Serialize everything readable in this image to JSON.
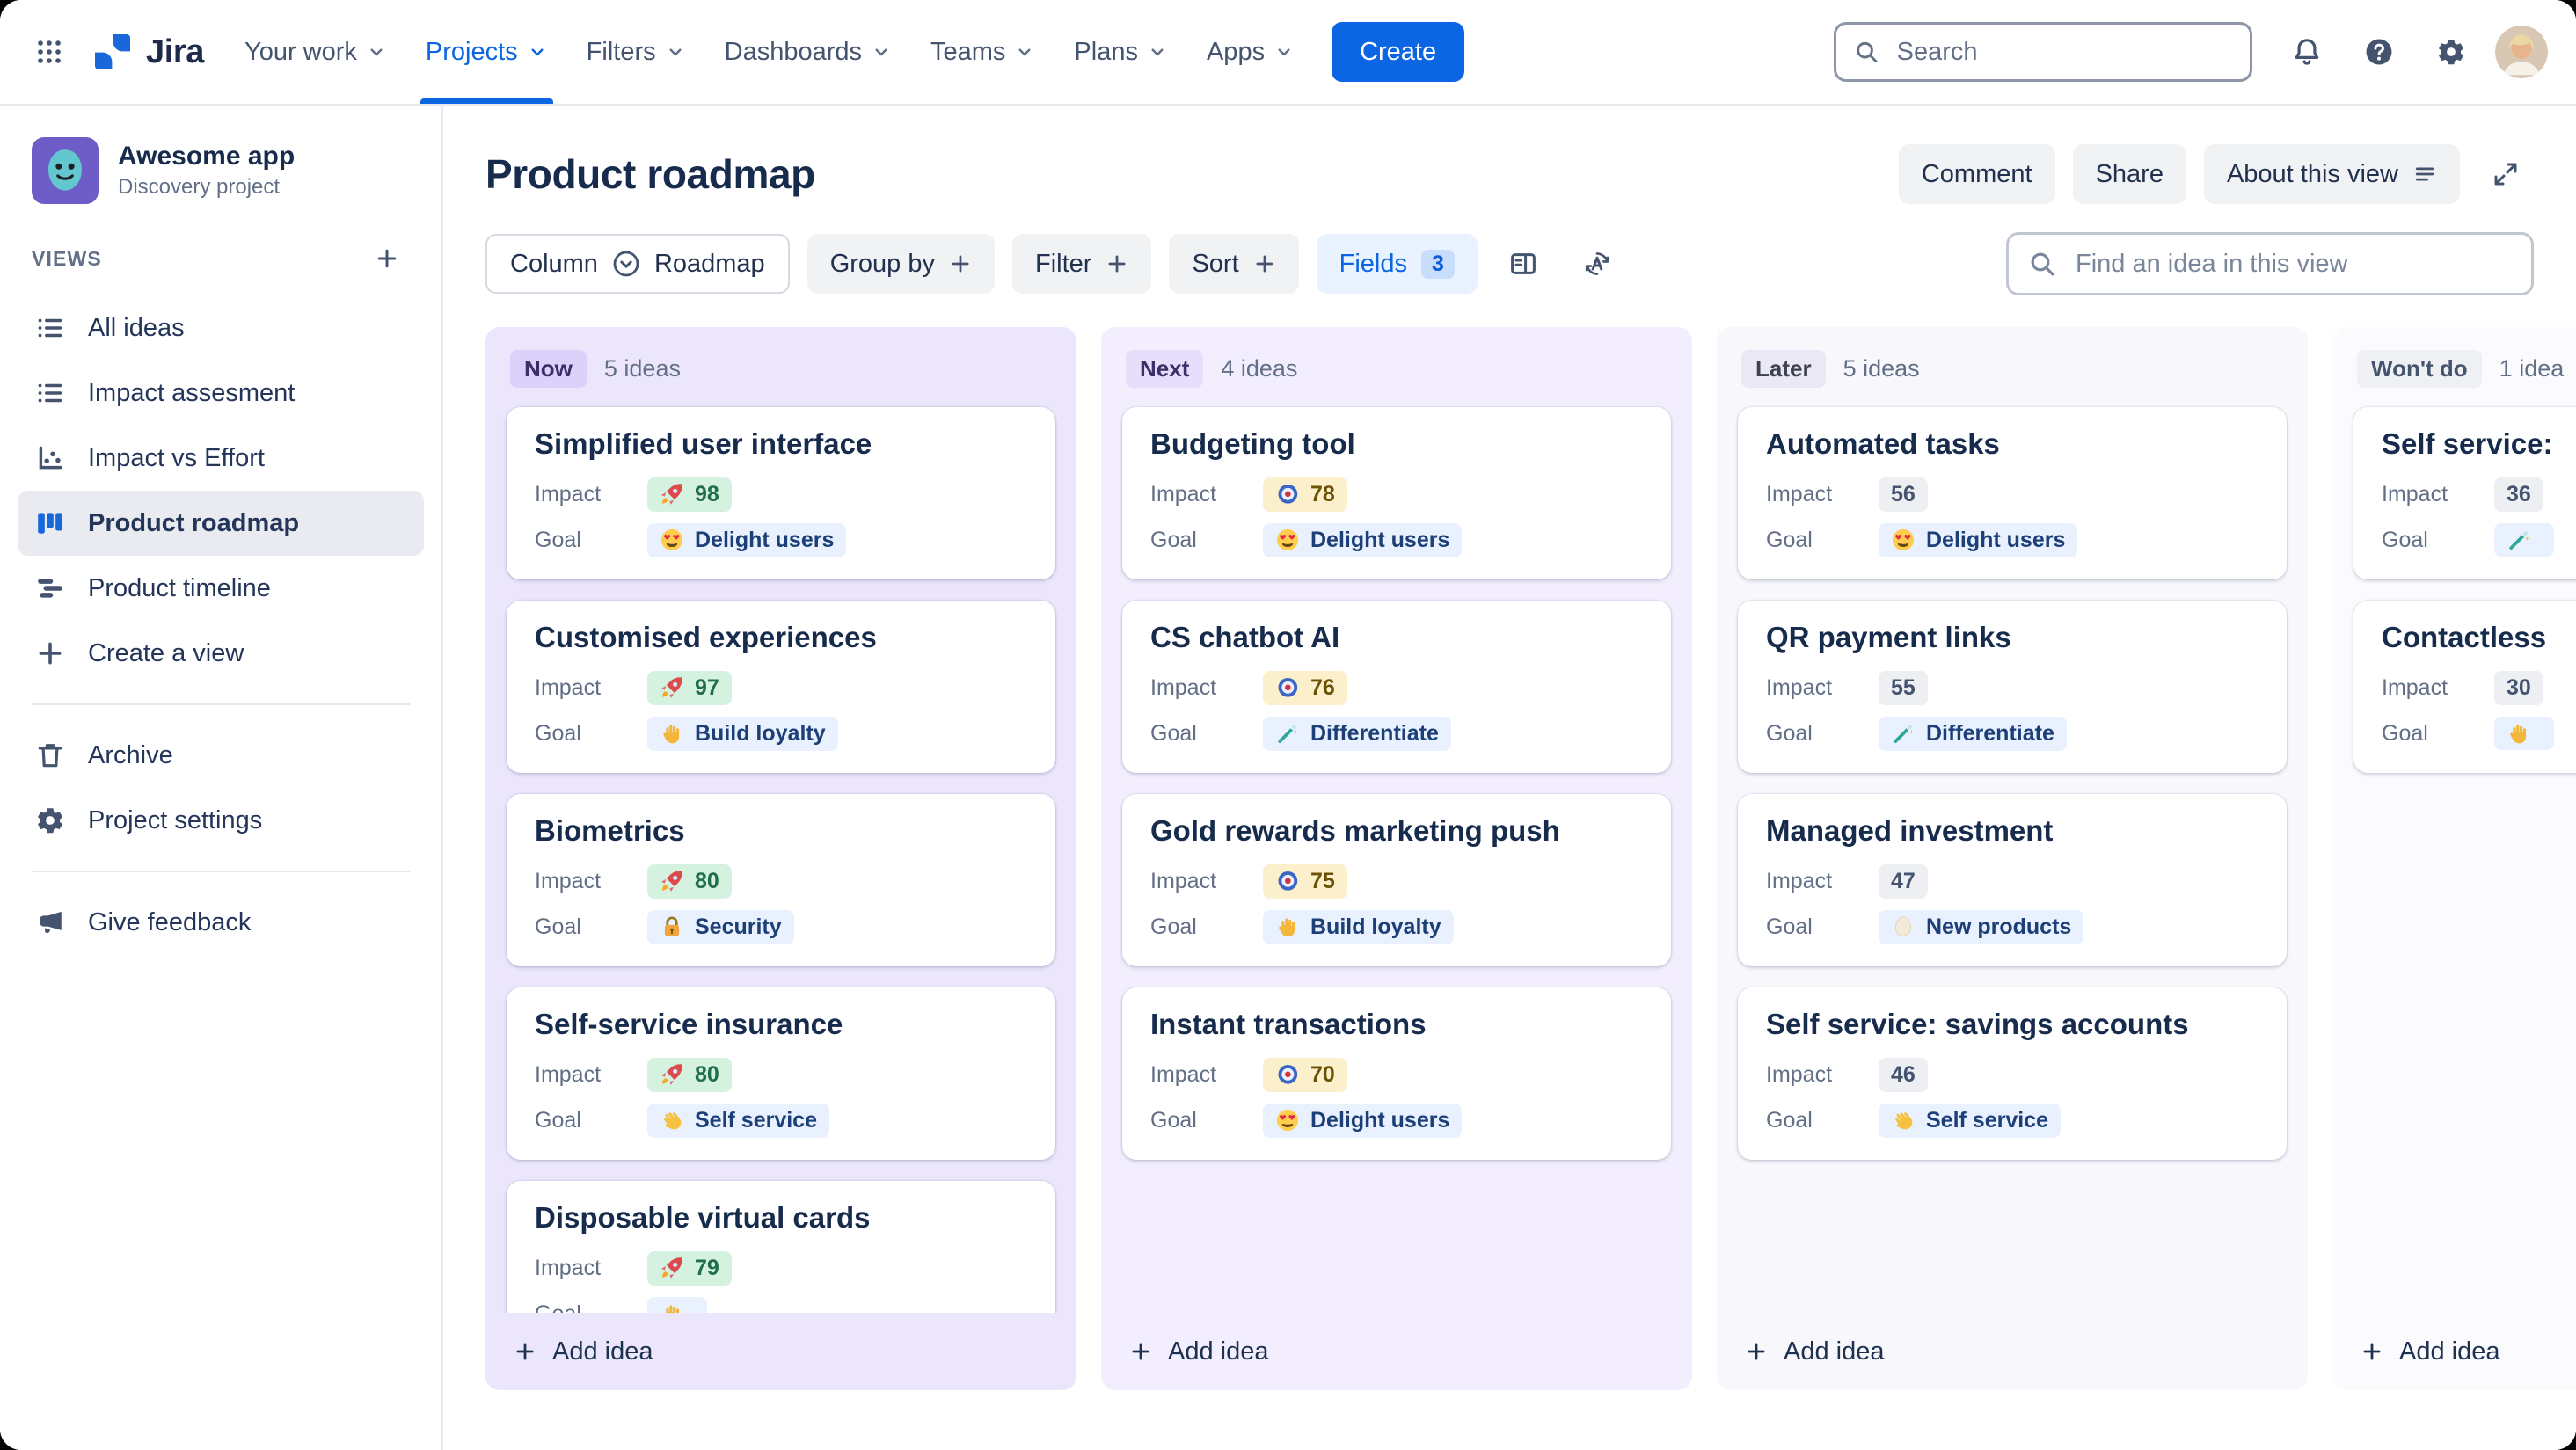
{
  "nav": {
    "logo": "Jira",
    "items": [
      {
        "label": "Your work"
      },
      {
        "label": "Projects"
      },
      {
        "label": "Filters"
      },
      {
        "label": "Dashboards"
      },
      {
        "label": "Teams"
      },
      {
        "label": "Plans"
      },
      {
        "label": "Apps"
      }
    ],
    "create_label": "Create",
    "search_placeholder": "Search"
  },
  "sidebar": {
    "project_name": "Awesome app",
    "project_type": "Discovery project",
    "views_label": "VIEWS",
    "views": [
      {
        "label": "All ideas"
      },
      {
        "label": "Impact assesment"
      },
      {
        "label": "Impact vs Effort"
      },
      {
        "label": "Product roadmap"
      },
      {
        "label": "Product timeline"
      },
      {
        "label": "Create a view"
      }
    ],
    "tools": [
      {
        "label": "Archive"
      },
      {
        "label": "Project settings"
      }
    ],
    "feedback_label": "Give feedback"
  },
  "header": {
    "title": "Product roadmap",
    "comment_label": "Comment",
    "share_label": "Share",
    "about_label": "About this view"
  },
  "toolbar": {
    "column_label": "Column",
    "column_value": "Roadmap",
    "group_by_label": "Group by",
    "filter_label": "Filter",
    "sort_label": "Sort",
    "fields_label": "Fields",
    "fields_count": "3",
    "find_placeholder": "Find an idea in this view"
  },
  "labels": {
    "impact": "Impact",
    "goal": "Goal",
    "add_idea": "Add idea"
  },
  "colors": {
    "accent_blue": "#0C66E4",
    "now_column": "#ECE6FC",
    "next_column": "#F2EEFD",
    "later_column": "#F7F7FC",
    "impact_high": "#D5F2E1",
    "impact_mid": "#FBF0CB",
    "impact_low": "#EDEFF2",
    "goal_badge": "#E8F1FD"
  },
  "board": {
    "columns": [
      {
        "status": "Now",
        "count": "5 ideas",
        "cards": [
          {
            "title": "Simplified user interface",
            "impact": "98",
            "impact_icon": "rocket-icon",
            "goal": "Delight users",
            "goal_icon": "heart-eyes-icon"
          },
          {
            "title": "Customised experiences",
            "impact": "97",
            "impact_icon": "rocket-icon",
            "goal": "Build loyalty",
            "goal_icon": "hand-icon"
          },
          {
            "title": "Biometrics",
            "impact": "80",
            "impact_icon": "rocket-icon",
            "goal": "Security",
            "goal_icon": "lock-icon"
          },
          {
            "title": "Self-service insurance",
            "impact": "80",
            "impact_icon": "rocket-icon",
            "goal": "Self service",
            "goal_icon": "call-me-hand-icon"
          },
          {
            "title": "Disposable virtual cards",
            "impact": "79",
            "impact_icon": "rocket-icon",
            "goal": ""
          }
        ]
      },
      {
        "status": "Next",
        "count": "4 ideas",
        "cards": [
          {
            "title": "Budgeting tool",
            "impact": "78",
            "impact_icon": "target-icon",
            "goal": "Delight users",
            "goal_icon": "heart-eyes-icon"
          },
          {
            "title": "CS chatbot AI",
            "impact": "76",
            "impact_icon": "target-icon",
            "goal": "Differentiate",
            "goal_icon": "wand-icon"
          },
          {
            "title": "Gold rewards marketing push",
            "impact": "75",
            "impact_icon": "target-icon",
            "goal": "Build loyalty",
            "goal_icon": "hand-icon"
          },
          {
            "title": "Instant transactions",
            "impact": "70",
            "impact_icon": "target-icon",
            "goal": "Delight users",
            "goal_icon": "heart-eyes-icon"
          }
        ]
      },
      {
        "status": "Later",
        "count": "5 ideas",
        "cards": [
          {
            "title": "Automated tasks",
            "impact": "56",
            "goal": "Delight users",
            "goal_icon": "heart-eyes-icon"
          },
          {
            "title": "QR payment links",
            "impact": "55",
            "goal": "Differentiate",
            "goal_icon": "wand-icon"
          },
          {
            "title": "Managed investment",
            "impact": "47",
            "goal": "New products",
            "goal_icon": "egg-icon"
          },
          {
            "title": "Self service: savings accounts",
            "impact": "46",
            "goal": "Self service",
            "goal_icon": "call-me-hand-icon"
          }
        ]
      },
      {
        "status": "Won't do",
        "count": "1 idea",
        "cards": [
          {
            "title": "Self service:",
            "impact": "36",
            "goal": ""
          },
          {
            "title": "Contactless",
            "impact": "30",
            "goal": ""
          }
        ]
      }
    ]
  }
}
